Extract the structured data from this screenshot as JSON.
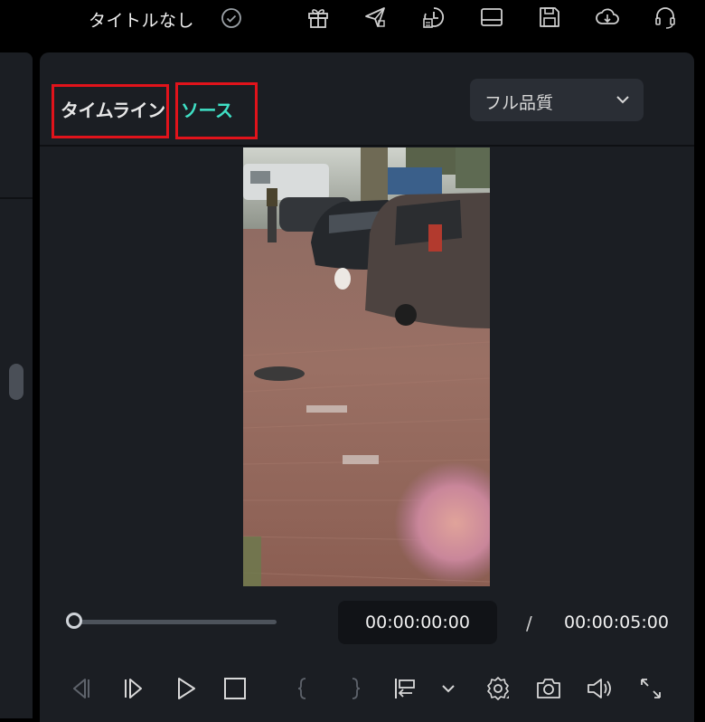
{
  "titlebar": {
    "project_title": "タイトルなし",
    "icons": [
      "check-circle-icon",
      "gift-icon",
      "send-icon",
      "export-icon",
      "layout-icon",
      "save-icon",
      "cloud-icon",
      "headset-icon"
    ]
  },
  "tabs": {
    "timeline": "タイムライン",
    "source": "ソース"
  },
  "quality": {
    "selected": "フル品質"
  },
  "playback": {
    "current_time": "00:00:00:00",
    "separator": "/",
    "total_time": "00:00:05:00",
    "progress": 0
  },
  "colors": {
    "accent": "#3fe0c5",
    "highlight": "#e1131b",
    "panel": "#1b1e23"
  },
  "controls": [
    "prev-frame-icon",
    "next-frame-icon",
    "play-icon",
    "stop-icon",
    "mark-in-icon",
    "mark-out-icon",
    "insert-icon",
    "chevron-down-icon",
    "settings-icon",
    "camera-icon",
    "volume-icon",
    "fullscreen-icon"
  ]
}
